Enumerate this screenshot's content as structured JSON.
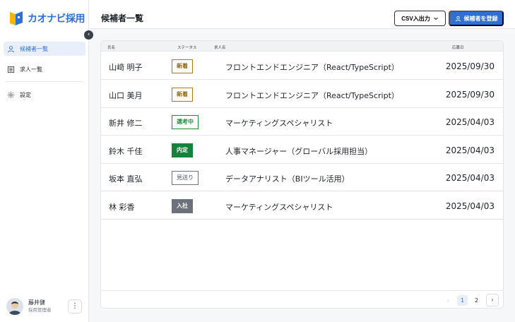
{
  "app": {
    "logo_text": "カオナビ採用",
    "collapse_icon": "chevron-left-icon"
  },
  "sidebar": {
    "items": [
      {
        "label": "候補者一覧",
        "icon": "user-icon",
        "active": true
      },
      {
        "label": "求人一覧",
        "icon": "list-icon",
        "active": false
      },
      {
        "label": "設定",
        "icon": "gear-icon",
        "active": false
      }
    ],
    "user": {
      "name": "藤井健",
      "role": "採用管理者",
      "menu_icon": "kebab-icon"
    }
  },
  "header": {
    "title": "候補者一覧",
    "csv_label": "CSV入出力",
    "register_label": "候補者を登録"
  },
  "table": {
    "columns": {
      "name": "氏名",
      "status": "ステータス",
      "job": "求人名",
      "date": "応募日"
    },
    "rows": [
      {
        "name": "山﨑 明子",
        "status": "新着",
        "job": "フロントエンドエンジニア（React/TypeScript）",
        "date": "2025/09/30"
      },
      {
        "name": "山口 美月",
        "status": "新着",
        "job": "フロントエンドエンジニア（React/TypeScript）",
        "date": "2025/09/30"
      },
      {
        "name": "新井 修二",
        "status": "選考中",
        "job": "マーケティングスペシャリスト",
        "date": "2025/04/03"
      },
      {
        "name": "鈴木 千佳",
        "status": "内定",
        "job": "人事マネージャー（グローバル採用担当）",
        "date": "2025/04/03"
      },
      {
        "name": "坂本 直弘",
        "status": "見送り",
        "job": "データアナリスト（BIツール活用）",
        "date": "2025/04/03"
      },
      {
        "name": "林 彩香",
        "status": "入社",
        "job": "マーケティングスペシャリスト",
        "date": "2025/04/03"
      }
    ]
  },
  "pagination": {
    "prev": "‹",
    "pages": [
      "1",
      "2"
    ],
    "current": "1",
    "next": "›"
  },
  "colors": {
    "accent": "#2f6fd6",
    "new": "#a27a17",
    "screening": "#1e8a3a",
    "offer": "#13823a",
    "rejected": "#6d727a",
    "joined": "#6d727a"
  }
}
